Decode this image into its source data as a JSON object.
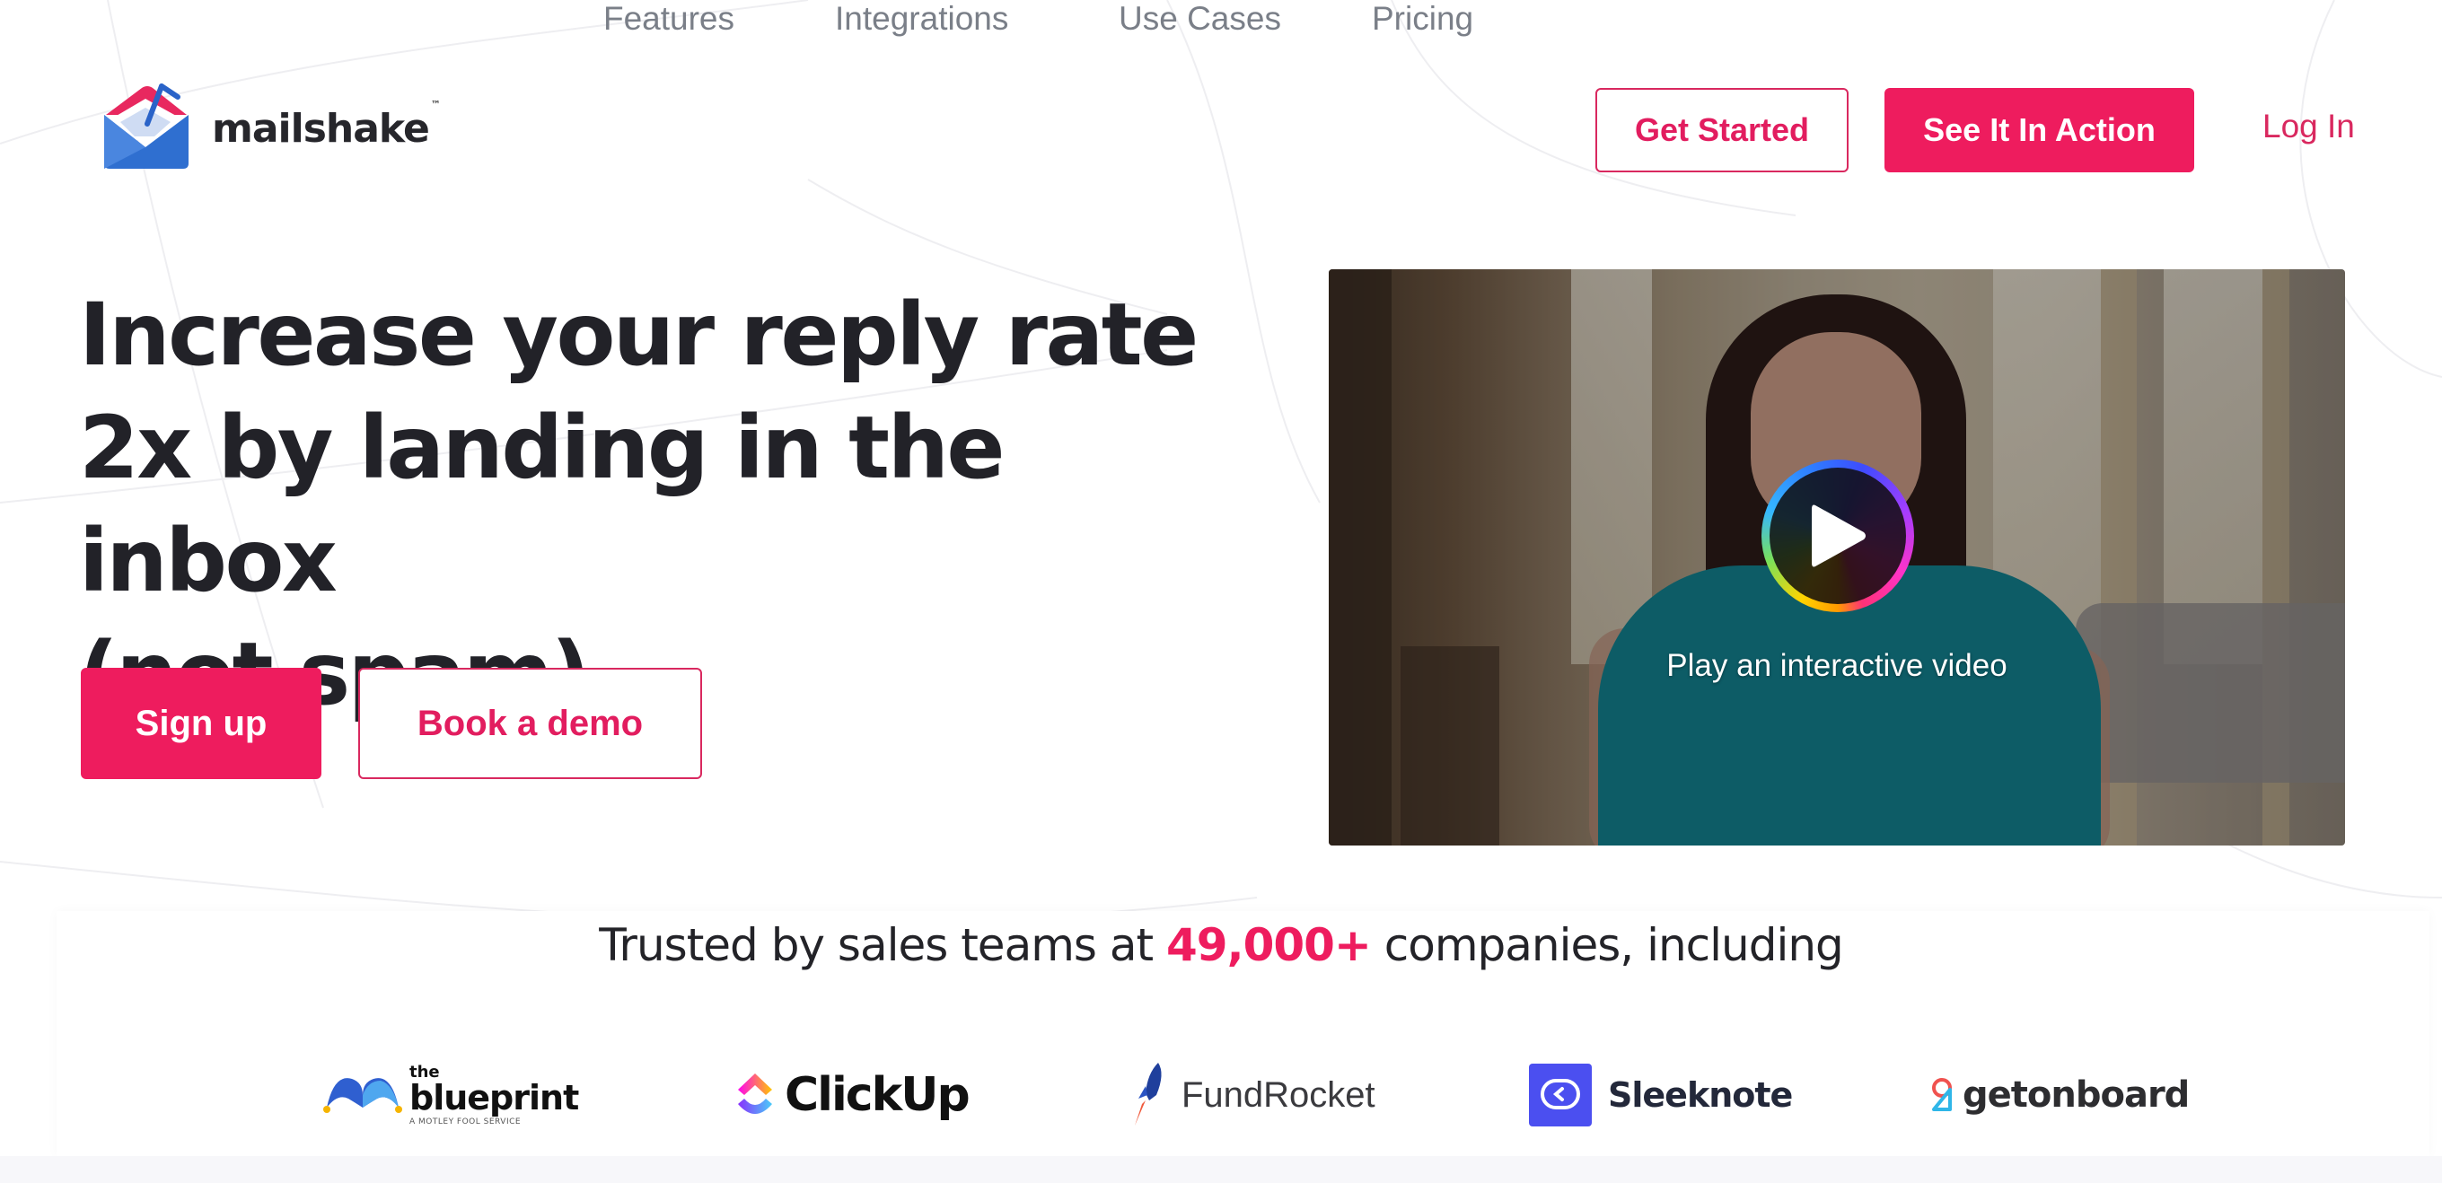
{
  "brand": {
    "name": "mailshake",
    "trademark": "™",
    "accent_color": "#ee1c5e"
  },
  "nav": {
    "items": [
      {
        "label": "Features"
      },
      {
        "label": "Integrations"
      },
      {
        "label": "Use Cases"
      },
      {
        "label": "Pricing"
      }
    ],
    "get_started_label": "Get Started",
    "see_in_action_label": "See It In Action",
    "login_label": "Log In"
  },
  "hero": {
    "title_lines": [
      "Increase your reply rate",
      "2x by landing in the inbox",
      "(not spam)."
    ],
    "signup_label": "Sign up",
    "demo_label": "Book a demo"
  },
  "video": {
    "caption": "Play an interactive video",
    "play_icon": "play-icon"
  },
  "trusted": {
    "prefix": "Trusted by sales teams at ",
    "count": "49,000+",
    "suffix": " companies, including",
    "logos": [
      {
        "name": "blueprint",
        "top": "the",
        "main": "blueprint",
        "sub": "A MOTLEY FOOL SERVICE"
      },
      {
        "name": "clickup",
        "main": "ClickUp"
      },
      {
        "name": "fundrocket",
        "main": "FundRocket"
      },
      {
        "name": "sleeknote",
        "main": "Sleeknote"
      },
      {
        "name": "getonboard",
        "main": "getonboard"
      }
    ]
  }
}
